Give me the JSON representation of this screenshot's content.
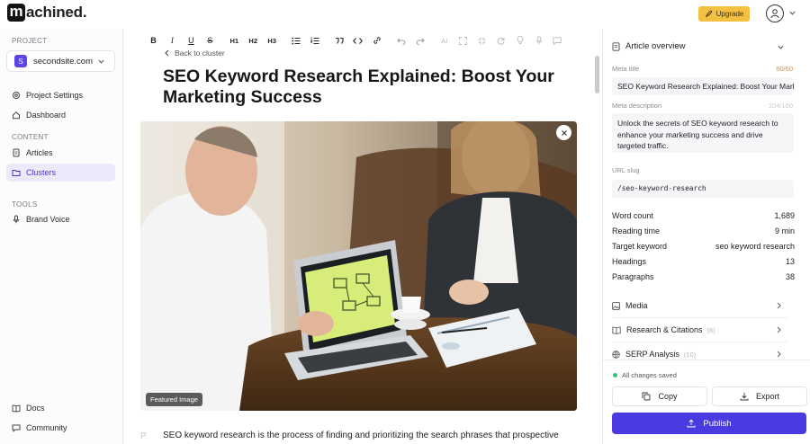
{
  "app": {
    "logo_letter": "m",
    "logo_rest": "achined.",
    "upgrade_label": "Upgrade"
  },
  "sidebar": {
    "project_label": "PROJECT",
    "project": {
      "initial": "S",
      "name": "secondsite.com"
    },
    "top_items": [
      {
        "label": "Project Settings",
        "icon": "gear-icon"
      },
      {
        "label": "Dashboard",
        "icon": "home-icon"
      }
    ],
    "content_label": "CONTENT",
    "content_items": [
      {
        "label": "Articles",
        "icon": "document-icon"
      },
      {
        "label": "Clusters",
        "icon": "folder-icon",
        "active": true
      }
    ],
    "tools_label": "TOOLS",
    "tools_items": [
      {
        "label": "Brand Voice",
        "icon": "microphone-icon"
      }
    ],
    "bottom_items": [
      {
        "label": "Docs",
        "icon": "book-icon"
      },
      {
        "label": "Community",
        "icon": "chat-icon"
      }
    ]
  },
  "toolbar": {
    "buttons": [
      "B",
      "I",
      "U",
      "S",
      "H1",
      "H2",
      "H3",
      "bullet-list",
      "numbered-list",
      "quote",
      "code",
      "link",
      "undo",
      "redo",
      "AI",
      "expand",
      "shrink",
      "refresh",
      "bulb",
      "mic",
      "comment"
    ]
  },
  "editor": {
    "back_label": "Back to cluster",
    "title": "SEO Keyword Research Explained: Boost Your Marketing Success",
    "image_caption": "Featured Image",
    "paragraph_marker": "P",
    "first_paragraph": "SEO keyword research is the process of finding and prioritizing the search phrases that prospective"
  },
  "panel": {
    "overview_title": "Article overview",
    "meta_title_label": "Meta title",
    "meta_title_count": "60/60",
    "meta_title_value": "SEO Keyword Research Explained: Boost Your Marketing Success",
    "meta_desc_label": "Meta description",
    "meta_desc_count": "104/160",
    "meta_desc_value": "Unlock the secrets of SEO keyword research to enhance your marketing success and drive targeted traffic.",
    "slug_label": "URL slug",
    "slug_value": "/seo-keyword-research",
    "stats": [
      {
        "label": "Word count",
        "value": "1,689"
      },
      {
        "label": "Reading time",
        "value": "9 min"
      },
      {
        "label": "Target keyword",
        "value": "seo keyword research"
      },
      {
        "label": "Headings",
        "value": "13"
      },
      {
        "label": "Paragraphs",
        "value": "38"
      }
    ],
    "sections": [
      {
        "label": "Media",
        "badge": ""
      },
      {
        "label": "Research & Citations",
        "badge": "(6)"
      },
      {
        "label": "SERP Analysis",
        "badge": "(10)"
      }
    ],
    "saved_status": "All changes saved",
    "copy_label": "Copy",
    "export_label": "Export",
    "publish_label": "Publish"
  },
  "colors": {
    "accent": "#4a3be0",
    "upgrade": "#f4c042",
    "active_bg": "#ece9fb",
    "saved_dot": "#34c27a"
  }
}
